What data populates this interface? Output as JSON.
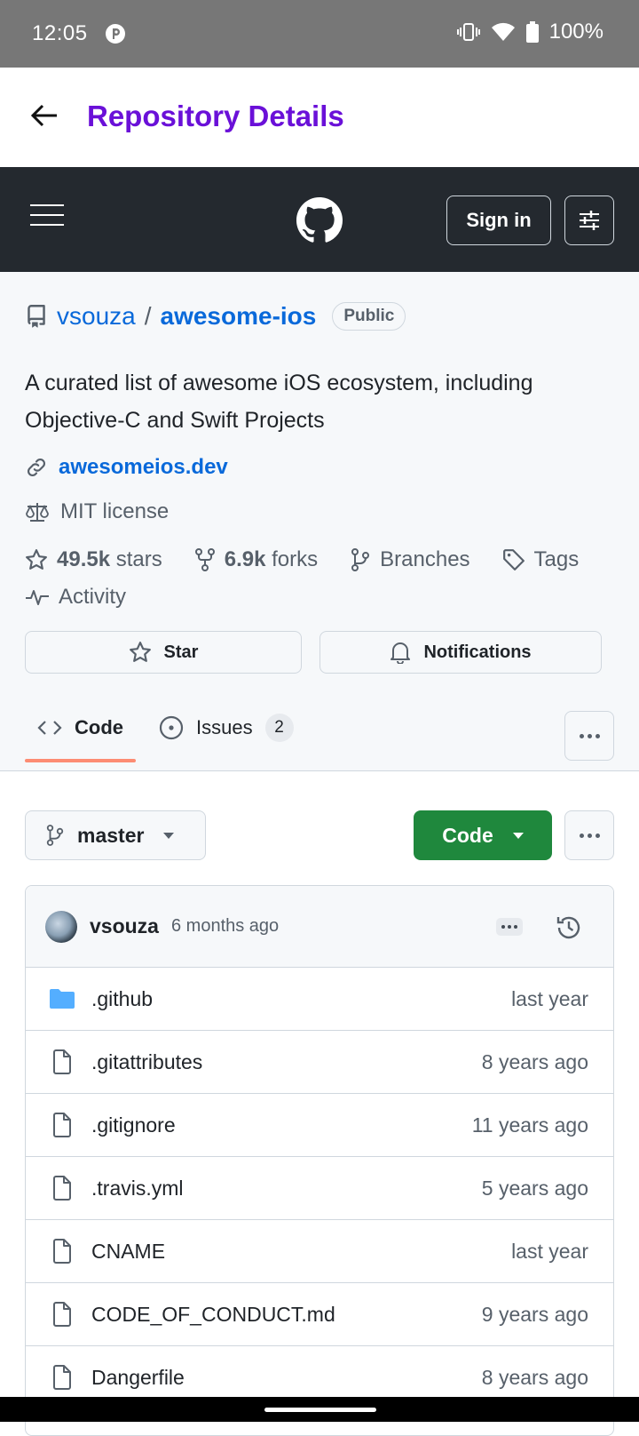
{
  "status_bar": {
    "time": "12:05",
    "battery": "100%"
  },
  "app_bar": {
    "title": "Repository Details"
  },
  "gh_header": {
    "sign_in": "Sign in"
  },
  "repo": {
    "owner": "vsouza",
    "separator": "/",
    "name": "awesome-ios",
    "visibility": "Public",
    "description": "A curated list of awesome iOS ecosystem, including Objective-C and Swift Projects",
    "website": "awesomeios.dev",
    "license": "MIT license",
    "stars_count": "49.5k",
    "stars_label": "stars",
    "forks_count": "6.9k",
    "forks_label": "forks",
    "branches_label": "Branches",
    "tags_label": "Tags",
    "activity_label": "Activity"
  },
  "actions": {
    "star": "Star",
    "notifications": "Notifications"
  },
  "tabs": [
    {
      "label": "Code",
      "active": true
    },
    {
      "label": "Issues",
      "count": "2"
    }
  ],
  "branch": {
    "name": "master"
  },
  "code_button": "Code",
  "latest_commit": {
    "user": "vsouza",
    "time": "6 months ago"
  },
  "files": [
    {
      "name": ".github",
      "age": "last year",
      "type": "folder"
    },
    {
      "name": ".gitattributes",
      "age": "8 years ago",
      "type": "file"
    },
    {
      "name": ".gitignore",
      "age": "11 years ago",
      "type": "file"
    },
    {
      "name": ".travis.yml",
      "age": "5 years ago",
      "type": "file"
    },
    {
      "name": "CNAME",
      "age": "last year",
      "type": "file"
    },
    {
      "name": "CODE_OF_CONDUCT.md",
      "age": "9 years ago",
      "type": "file"
    },
    {
      "name": "Dangerfile",
      "age": "8 years ago",
      "type": "file"
    }
  ],
  "colors": {
    "app_title": "#6a10d8",
    "header_bg": "#24292f",
    "link": "#0969da",
    "code_button": "#1f883d",
    "tab_underline": "#fd8c73",
    "folder": "#54aeff"
  }
}
